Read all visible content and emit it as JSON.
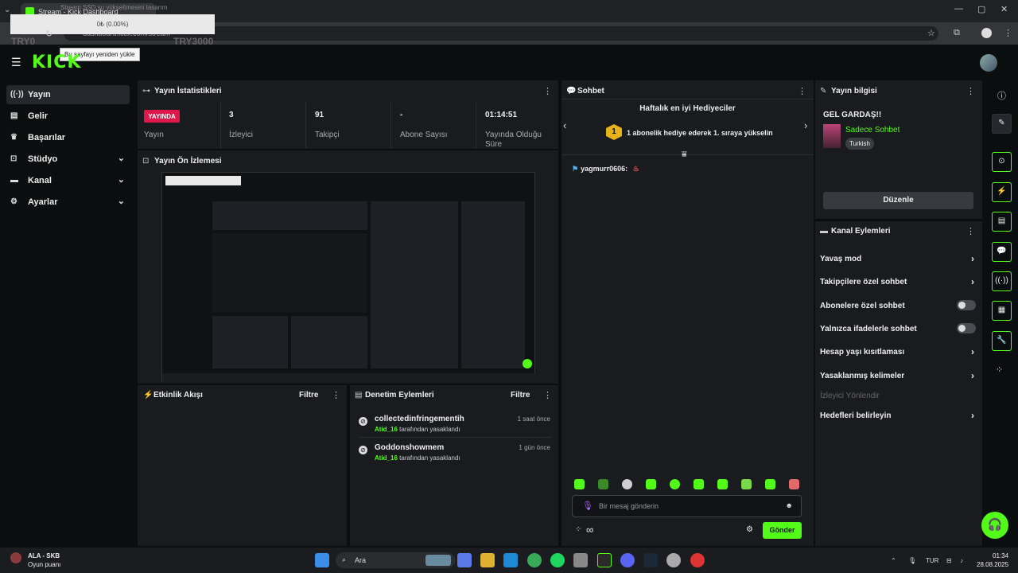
{
  "browser": {
    "tab_title": "Stream - Kick Dashboard",
    "tab_overlay": "Stream SSD şu yükseltmesini tasarım",
    "url": "dashboard.kick.com/stream",
    "download_text": "0₺ (0.00%)",
    "try_low": "TRY0",
    "try_high": "TRY3000",
    "tooltip": "Bu sayfayı yeniden yükle"
  },
  "app": {
    "logo": "KICK"
  },
  "sidebar": {
    "items": [
      {
        "label": "Yayın",
        "icon": "broadcast-icon",
        "active": true
      },
      {
        "label": "Gelir",
        "icon": "revenue-icon"
      },
      {
        "label": "Başarılar",
        "icon": "trophy-icon"
      },
      {
        "label": "Stüdyo",
        "icon": "studio-icon",
        "expandable": true
      },
      {
        "label": "Kanal",
        "icon": "channel-icon",
        "expandable": true
      },
      {
        "label": "Ayarlar",
        "icon": "gear-icon",
        "expandable": true
      }
    ]
  },
  "stats": {
    "title": "Yayın İstatistikleri",
    "live_badge": "YAYINDA",
    "live_label": "Yayın",
    "viewers_value": "3",
    "viewers_label": "İzleyici",
    "followers_value": "91",
    "followers_label": "Takipçi",
    "subs_value": "-",
    "subs_label": "Abone Sayısı",
    "uptime_value": "01:14:51",
    "uptime_label": "Yayında Olduğu Süre"
  },
  "preview": {
    "title": "Yayın Ön İzlemesi"
  },
  "activity": {
    "title": "Etkinlik Akışı",
    "filter": "Filtre"
  },
  "moderation": {
    "title": "Denetim Eylemleri",
    "filter": "Filtre",
    "rows": [
      {
        "name": "collectedinfringementih",
        "time": "1 saat önce",
        "by": "Atid_16",
        "suffix": "tarafından yasaklandı"
      },
      {
        "name": "Goddonshowmem",
        "time": "1 gün önce",
        "by": "Atid_16",
        "suffix": "tarafından yasaklandı"
      }
    ]
  },
  "chat": {
    "title": "Sohbet",
    "gifters_title": "Haftalık en iyi Hediyeciler",
    "gift_rank": "1",
    "gift_text": "1 abonelik hediye ederek 1. sıraya yükselin",
    "message_user": "yagmurr0606:",
    "input_placeholder": "Bir mesaj gönderin",
    "infinity": "∞",
    "send_label": "Gönder"
  },
  "stream_info": {
    "title": "Yayın bilgisi",
    "stream_title": "GEL GARDAŞ!!",
    "category": "Sadece Sohbet",
    "tag": "Turkish",
    "edit_label": "Düzenle"
  },
  "channel_actions": {
    "title": "Kanal Eylemleri",
    "rows": [
      {
        "label": "Yavaş mod",
        "control": "arrow"
      },
      {
        "label": "Takipçilere özel sohbet",
        "control": "arrow"
      },
      {
        "label": "Abonelere özel sohbet",
        "control": "toggle"
      },
      {
        "label": "Yalnızca ifadelerle sohbet",
        "control": "toggle"
      },
      {
        "label": "Hesap yaşı kısıtlaması",
        "control": "arrow"
      },
      {
        "label": "Yasaklanmış kelimeler",
        "control": "arrow"
      },
      {
        "label": "İzleyici Yönlendir",
        "control": "none",
        "disabled": true
      },
      {
        "label": "Hedefleri belirleyin",
        "control": "arrow"
      }
    ]
  },
  "taskbar": {
    "weather_title": "ALA - SKB",
    "weather_sub": "Oyun puanı",
    "search_label": "Ara",
    "lang": "TUR",
    "time": "01:34",
    "date": "28.08.2025"
  },
  "colors": {
    "accent": "#53fc18",
    "live": "#e0174a",
    "panel": "#191b1f",
    "background": "#0b0e0f"
  }
}
